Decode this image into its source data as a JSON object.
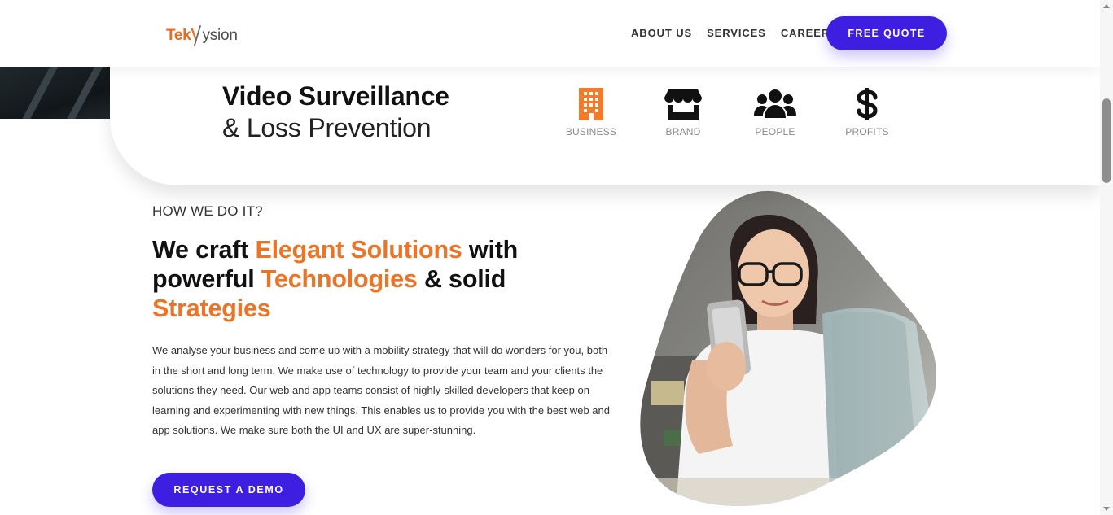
{
  "brand": {
    "logo_part1": "Tek",
    "logo_part2": "ysion",
    "accent_color": "#ee7324",
    "primary_color": "#3e1ee0"
  },
  "nav": {
    "links": [
      {
        "label": "ABOUT US"
      },
      {
        "label": "SERVICES"
      },
      {
        "label": "CAREERS"
      }
    ],
    "cta_label": "FREE QUOTE"
  },
  "hero": {
    "title_line1": "Video Surveillance",
    "title_line2": "& Loss Prevention",
    "features": [
      {
        "label": "BUSINESS",
        "icon": "building-icon",
        "color": "#f47a28"
      },
      {
        "label": "BRAND",
        "icon": "storefront-icon",
        "color": "#111111"
      },
      {
        "label": "PEOPLE",
        "icon": "users-icon",
        "color": "#111111"
      },
      {
        "label": "PROFITS",
        "icon": "dollar-icon",
        "color": "#111111"
      }
    ]
  },
  "section": {
    "eyebrow": "HOW WE DO IT?",
    "headline": {
      "p1": "We craft ",
      "h1": "Elegant Solutions",
      "p2": " with powerful ",
      "h2": "Technologies",
      "p3": " & solid ",
      "h3": "Strategies"
    },
    "body": "We analyse your business and come up with a mobility strategy that will do wonders for you, both in the short and long term. We make use of technology to provide your team and your clients the solutions they need. Our web and app teams consist of highly-skilled developers that keep on learning and experimenting with new things. This enables us to provide you with the best web and app solutions. We make sure both the UI and UX are super-stunning.",
    "cta_label": "REQUEST A DEMO"
  }
}
